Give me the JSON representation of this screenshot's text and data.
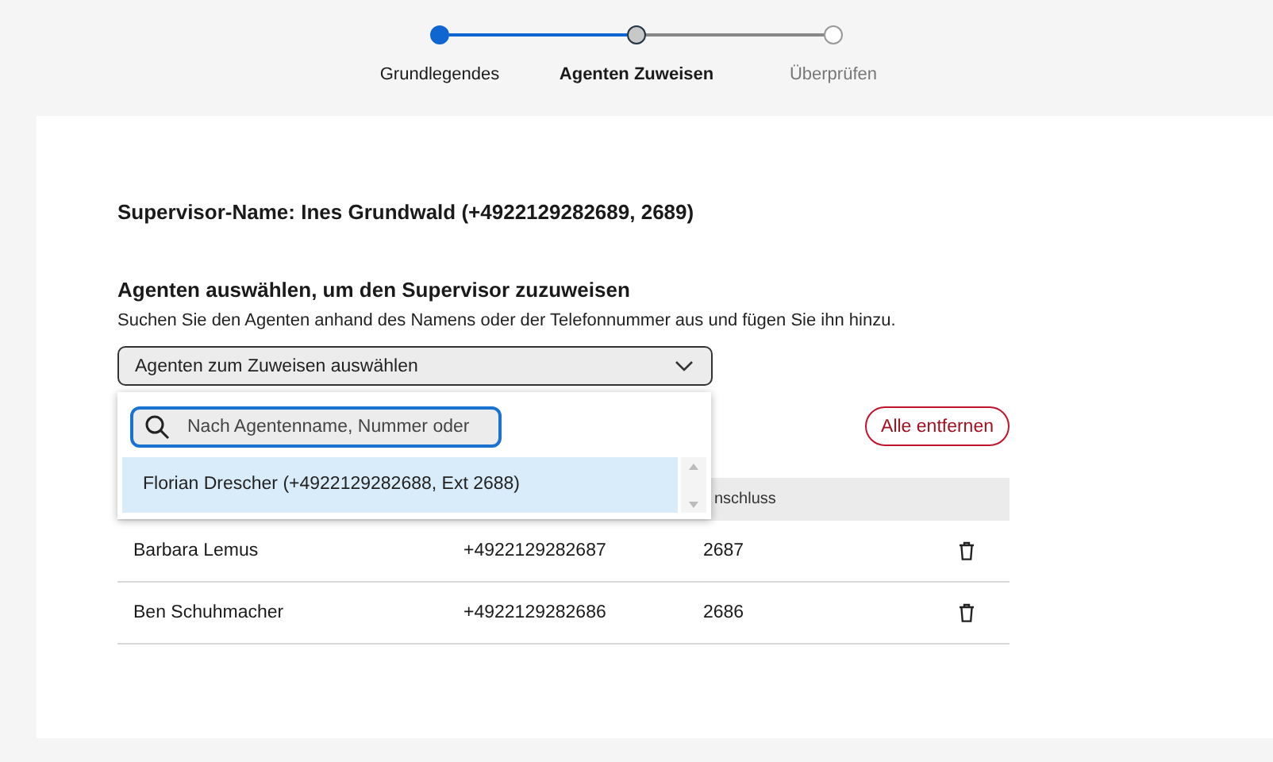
{
  "stepper": [
    {
      "label": "Grundlegendes",
      "completed": true,
      "selected": false
    },
    {
      "label": "Agenten Zuweisen",
      "completed": false,
      "selected": true
    },
    {
      "label": "Überprüfen",
      "completed": false,
      "selected": false
    }
  ],
  "supervisor": "Supervisor-Name: Ines Grundwald (+4922129282689, 2689)",
  "section_title": "Agenten auswählen, um den Supervisor zuzuweisen",
  "section_hint": "Suchen Sie den Agenten anhand des Namens oder der Telefonnummer aus und fügen Sie ihn hinzu.",
  "select": {
    "placeholder": "Agenten zum Zuweisen auswählen",
    "expanded": true
  },
  "dropdown": {
    "search_placeholder": "Nach Agentenname, Nummer oder",
    "options": [
      {
        "label": "Florian Drescher (+4922129282688, Ext 2688)",
        "selected": true
      }
    ]
  },
  "remove_all": "Alle entfernen",
  "table": {
    "visible_header": "nschluss",
    "rows": [
      {
        "name": "Barbara Lemus",
        "phone": "+4922129282687",
        "ext": "2687"
      },
      {
        "name": "Ben Schuhmacher",
        "phone": "+4922129282686",
        "ext": "2686"
      }
    ]
  }
}
